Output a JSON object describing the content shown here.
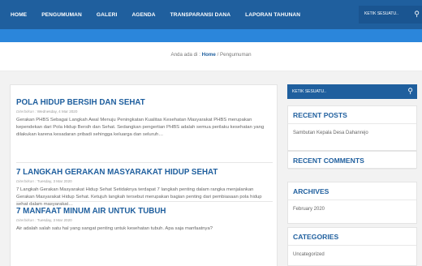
{
  "nav": {
    "items": [
      "HOME",
      "PENGUMUMAN",
      "GALERI",
      "AGENDA",
      "TRANSPARANSI DANA",
      "LAPORAN TAHUNAN"
    ],
    "search_placeholder": "KETIK SESUATU..",
    "search_icon": "search-icon"
  },
  "breadcrumb": {
    "prefix": "Anda ada di : ",
    "home": "Home",
    "separator": " / ",
    "current": "Pengumuman"
  },
  "posts": [
    {
      "title": "POLA HIDUP BERSIH DAN SEHAT",
      "date_prefix": "Diterbitkan : ",
      "date": "Wednesday, 4 Mar 2020",
      "excerpt": "Gerakan PHBS Sebagai Langkah Awal Menuju Peningkatan Kualitas Kesehatan Masyarakat PHBS merupakan kependekan dari Pola Hidup Bersih dan Sehat. Sedangkan pengertian PHBS adalah semua perilaku kesehatan yang dilakukan karena kesadaran pribadi sehingga keluarga dan seluruh…"
    },
    {
      "title": "7 LANGKAH GERAKAN MASYARAKAT HIDUP SEHAT",
      "date_prefix": "Diterbitkan : ",
      "date": "Tuesday, 3 Mar 2020",
      "excerpt": "7 Langkah Gerakan Masyarakat Hidup Sehat Setidaknya terdapat 7 langkah penting dalam rangka menjalankan Gerakan Masyarakat Hidup Sehat. Ketujuh langkah tersebut merupakan bagian penting dari pembiasaan pola hidup sehat dalam masyarakat…"
    },
    {
      "title": "7 MANFAAT MINUM AIR UNTUK TUBUH",
      "date_prefix": "Diterbitkan : ",
      "date": "Tuesday, 3 Mar 2020",
      "excerpt": "Air adalah salah satu hal yang sangat penting untuk kesehatan tubuh. Apa saja manfaatnya?"
    }
  ],
  "sidebar": {
    "search_placeholder": "KETIK SESUATU..",
    "recent_posts_title": "RECENT POSTS",
    "recent_posts": [
      "Sambutan Kepala Desa Dahanrejo"
    ],
    "recent_comments_title": "RECENT COMMENTS",
    "archives_title": "ARCHIVES",
    "archives": [
      "February 2020"
    ],
    "categories_title": "CATEGORIES",
    "categories": [
      "Uncategorized"
    ]
  },
  "colors": {
    "nav_bg": "#1f5f9e",
    "accent_bar": "#2b86db",
    "heading": "#1f5f9e",
    "page_bg": "#f2f2f2"
  }
}
